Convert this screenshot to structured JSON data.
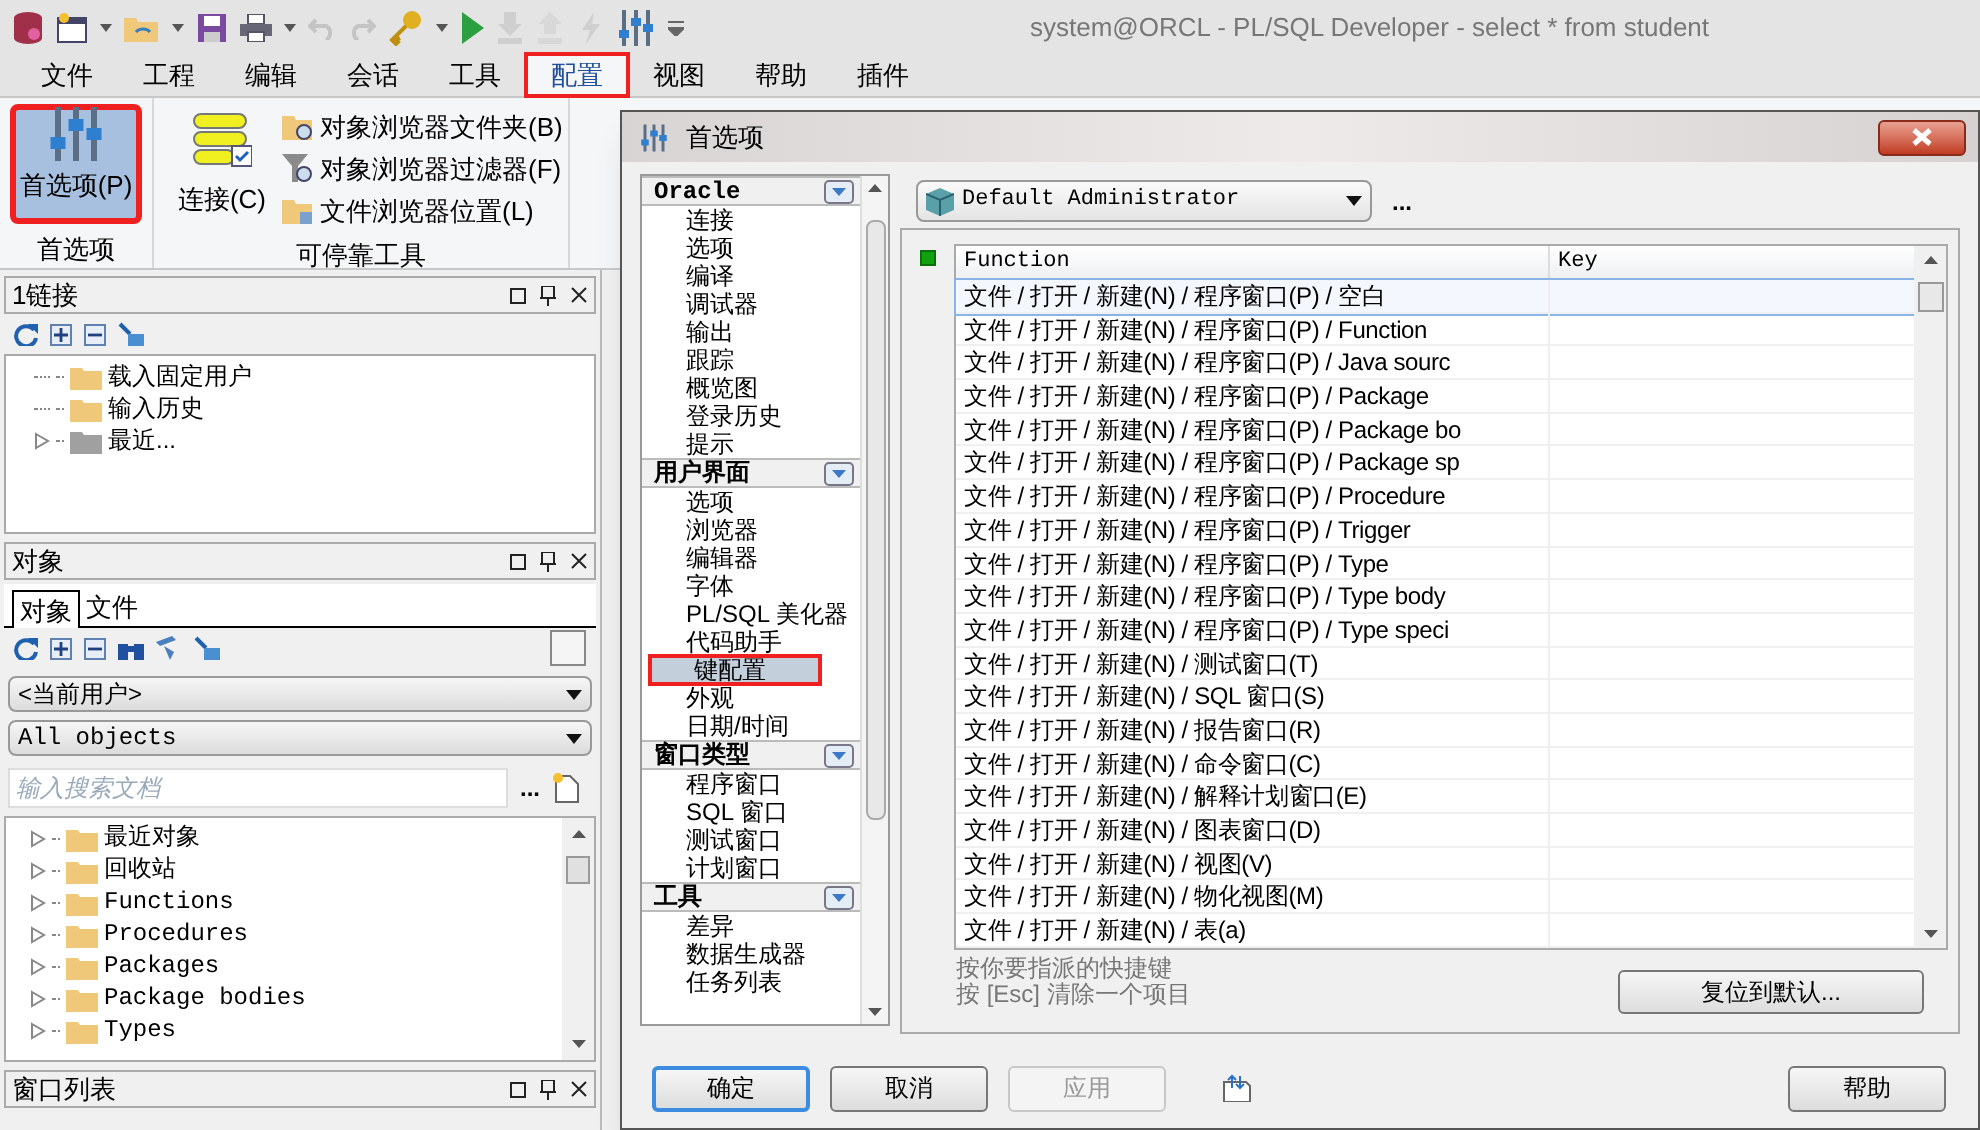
{
  "window": {
    "title": "system@ORCL - PL/SQL Developer - select * from student"
  },
  "menu_tabs": [
    {
      "label": "文件",
      "selected": false,
      "highlighted": false
    },
    {
      "label": "工程",
      "selected": false,
      "highlighted": false
    },
    {
      "label": "编辑",
      "selected": false,
      "highlighted": false
    },
    {
      "label": "会话",
      "selected": false,
      "highlighted": false
    },
    {
      "label": "工具",
      "selected": false,
      "highlighted": false
    },
    {
      "label": "配置",
      "selected": true,
      "highlighted": true
    },
    {
      "label": "视图",
      "selected": false,
      "highlighted": false
    },
    {
      "label": "帮助",
      "selected": false,
      "highlighted": false
    },
    {
      "label": "插件",
      "selected": false,
      "highlighted": false
    }
  ],
  "ribbon": {
    "preferences_group": {
      "label": "首选项",
      "button": {
        "label": "首选项(P)",
        "selected": true,
        "highlighted": true
      }
    },
    "dockable_group": {
      "label": "可停靠工具",
      "button": {
        "label": "连接(C)"
      },
      "items": [
        "对象浏览器文件夹(B)",
        "对象浏览器过滤器(F)",
        "文件浏览器位置(L)"
      ]
    }
  },
  "connections_panel": {
    "title": "1链接",
    "tree": [
      {
        "label": "载入固定用户",
        "kind": "folder",
        "expandable": false
      },
      {
        "label": "输入历史",
        "kind": "folder",
        "expandable": false
      },
      {
        "label": "最近...",
        "kind": "recent",
        "expandable": true
      }
    ]
  },
  "objects_panel": {
    "title": "对象",
    "tabs": [
      {
        "label": "对象",
        "selected": true
      },
      {
        "label": "文件",
        "selected": false
      }
    ],
    "user_select": "<当前用户>",
    "filter_select": "All objects",
    "search": {
      "placeholder": "输入搜索文档"
    },
    "more_button": "...",
    "tree": [
      {
        "label": "最近对象",
        "expandable": true
      },
      {
        "label": "回收站",
        "expandable": true
      },
      {
        "label": "Functions",
        "expandable": true
      },
      {
        "label": "Procedures",
        "expandable": true
      },
      {
        "label": "Packages",
        "expandable": true
      },
      {
        "label": "Package bodies",
        "expandable": true
      },
      {
        "label": "Types",
        "expandable": true
      }
    ]
  },
  "window_list_panel": {
    "title": "窗口列表"
  },
  "dialog": {
    "title": "首选项",
    "nav": [
      {
        "label": "Oracle",
        "items": [
          {
            "label": "连接",
            "selected": false
          },
          {
            "label": "选项",
            "selected": false
          },
          {
            "label": "编译",
            "selected": false
          },
          {
            "label": "调试器",
            "selected": false
          },
          {
            "label": "输出",
            "selected": false
          },
          {
            "label": "跟踪",
            "selected": false
          },
          {
            "label": "概览图",
            "selected": false
          },
          {
            "label": "登录历史",
            "selected": false
          },
          {
            "label": "提示",
            "selected": false
          }
        ]
      },
      {
        "label": "用户界面",
        "items": [
          {
            "label": "选项",
            "selected": false
          },
          {
            "label": "浏览器",
            "selected": false
          },
          {
            "label": "编辑器",
            "selected": false
          },
          {
            "label": "字体",
            "selected": false
          },
          {
            "label": "PL/SQL 美化器",
            "selected": false
          },
          {
            "label": "代码助手",
            "selected": false
          },
          {
            "label": "键配置",
            "selected": true,
            "highlighted": true
          },
          {
            "label": "外观",
            "selected": false
          },
          {
            "label": "日期/时间",
            "selected": false
          }
        ]
      },
      {
        "label": "窗口类型",
        "items": [
          {
            "label": "程序窗口",
            "selected": false
          },
          {
            "label": "SQL 窗口",
            "selected": false
          },
          {
            "label": "测试窗口",
            "selected": false
          },
          {
            "label": "计划窗口",
            "selected": false
          }
        ]
      },
      {
        "label": "工具",
        "items": [
          {
            "label": "差异",
            "selected": false
          },
          {
            "label": "数据生成器",
            "selected": false
          },
          {
            "label": "任务列表",
            "selected": false
          }
        ]
      }
    ],
    "profile": "Default Administrator",
    "profile_more": "...",
    "table": {
      "columns": [
        "Function",
        "Key"
      ],
      "rows": [
        {
          "function": "文件 / 打开 / 新建(N) / 程序窗口(P) / 空白",
          "selected": true
        },
        {
          "function": "文件 / 打开 / 新建(N) / 程序窗口(P) / Function",
          "selected": false
        },
        {
          "function": "文件 / 打开 / 新建(N) / 程序窗口(P) / Java sourc",
          "selected": false
        },
        {
          "function": "文件 / 打开 / 新建(N) / 程序窗口(P) / Package",
          "selected": false
        },
        {
          "function": "文件 / 打开 / 新建(N) / 程序窗口(P) / Package bo",
          "selected": false
        },
        {
          "function": "文件 / 打开 / 新建(N) / 程序窗口(P) / Package sp",
          "selected": false
        },
        {
          "function": "文件 / 打开 / 新建(N) / 程序窗口(P) / Procedure",
          "selected": false
        },
        {
          "function": "文件 / 打开 / 新建(N) / 程序窗口(P) / Trigger",
          "selected": false
        },
        {
          "function": "文件 / 打开 / 新建(N) / 程序窗口(P) / Type",
          "selected": false
        },
        {
          "function": "文件 / 打开 / 新建(N) / 程序窗口(P) / Type body",
          "selected": false
        },
        {
          "function": "文件 / 打开 / 新建(N) / 程序窗口(P) / Type speci",
          "selected": false
        },
        {
          "function": "文件 / 打开 / 新建(N) / 测试窗口(T)",
          "selected": false
        },
        {
          "function": "文件 / 打开 / 新建(N) / SQL 窗口(S)",
          "selected": false
        },
        {
          "function": "文件 / 打开 / 新建(N) / 报告窗口(R)",
          "selected": false
        },
        {
          "function": "文件 / 打开 / 新建(N) / 命令窗口(C)",
          "selected": false
        },
        {
          "function": "文件 / 打开 / 新建(N) / 解释计划窗口(E)",
          "selected": false
        },
        {
          "function": "文件 / 打开 / 新建(N) / 图表窗口(D)",
          "selected": false
        },
        {
          "function": "文件 / 打开 / 新建(N) / 视图(V)",
          "selected": false
        },
        {
          "function": "文件 / 打开 / 新建(N) / 物化视图(M)",
          "selected": false
        },
        {
          "function": "文件 / 打开 / 新建(N) / 表(a)",
          "selected": false
        }
      ]
    },
    "hints": [
      "按你要指派的快捷键",
      "按 [Esc] 清除一个项目"
    ],
    "reset_button": "复位到默认...",
    "buttons": [
      {
        "label": "确定",
        "disabled": false,
        "focused": true
      },
      {
        "label": "取消",
        "disabled": false,
        "focused": false
      },
      {
        "label": "应用",
        "disabled": true,
        "focused": false
      }
    ],
    "help_button": "帮助"
  }
}
